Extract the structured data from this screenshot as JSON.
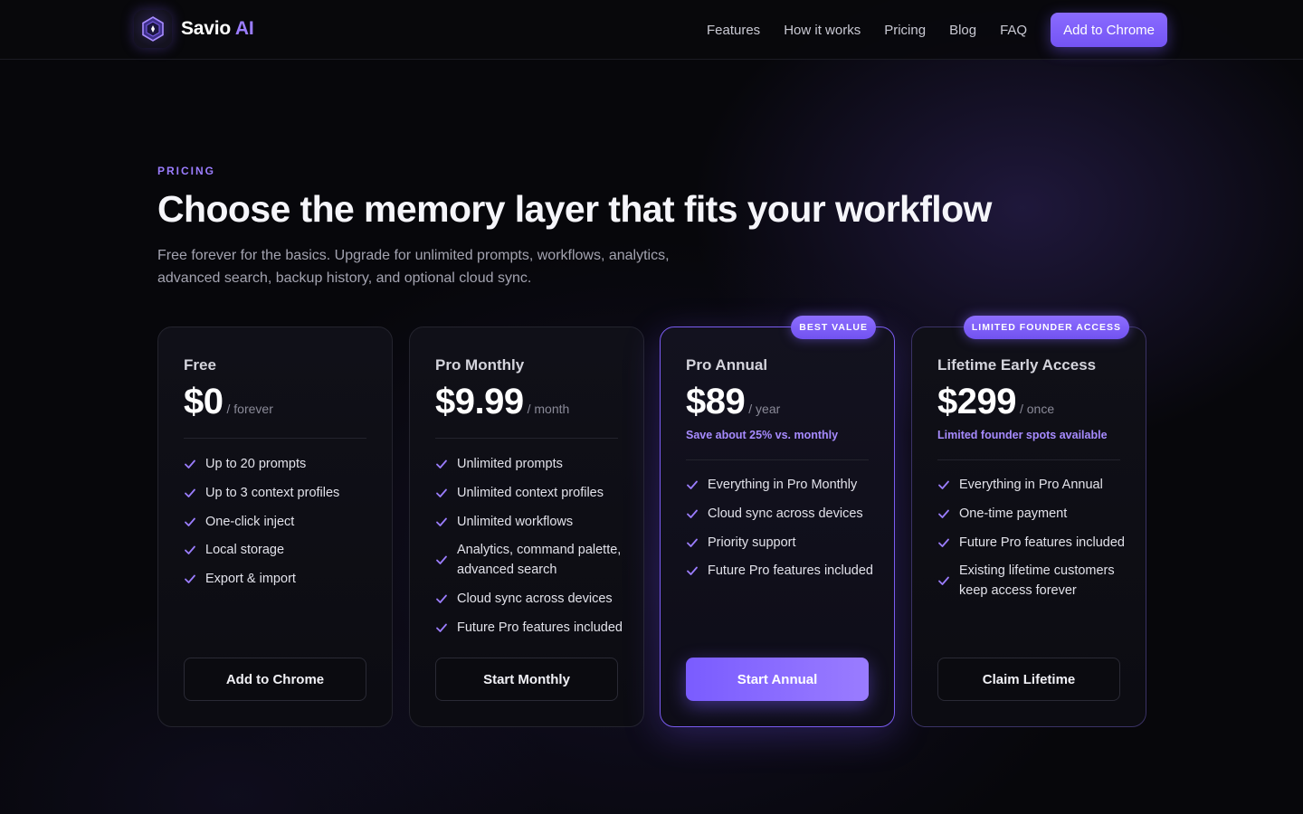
{
  "nav": {
    "brand": "Savio",
    "brand_accent": "AI",
    "links": [
      "Features",
      "How it works",
      "Pricing",
      "Blog",
      "FAQ"
    ],
    "cta": "Add to Chrome"
  },
  "hero": {
    "eyebrow": "PRICING",
    "title": "Choose the memory layer that fits your workflow",
    "subtitle": "Free forever for the basics. Upgrade for unlimited prompts, workflows, analytics, advanced search, backup history, and optional cloud sync."
  },
  "plans": [
    {
      "name": "Free",
      "price": "$0",
      "period": "/ forever",
      "features": [
        "Up to 20 prompts",
        "Up to 3 context profiles",
        "One-click inject",
        "Local storage",
        "Export & import"
      ],
      "button": "Add to Chrome"
    },
    {
      "name": "Pro Monthly",
      "price": "$9.99",
      "period": "/ month",
      "features": [
        "Unlimited prompts",
        "Unlimited context profiles",
        "Unlimited workflows",
        "Analytics, command palette, advanced search",
        "Cloud sync across devices",
        "Future Pro features included"
      ],
      "button": "Start Monthly"
    },
    {
      "badge": "BEST VALUE",
      "name": "Pro Annual",
      "price": "$89",
      "period": "/ year",
      "note": "Save about 25% vs. monthly",
      "features": [
        "Everything in Pro Monthly",
        "Cloud sync across devices",
        "Priority support",
        "Future Pro features included"
      ],
      "button": "Start Annual"
    },
    {
      "badge": "LIMITED FOUNDER ACCESS",
      "name": "Lifetime Early Access",
      "price": "$299",
      "period": "/ once",
      "note": "Limited founder spots available",
      "features": [
        "Everything in Pro Annual",
        "One-time payment",
        "Future Pro features included",
        "Existing lifetime customers keep access forever"
      ],
      "button": "Claim Lifetime"
    }
  ]
}
